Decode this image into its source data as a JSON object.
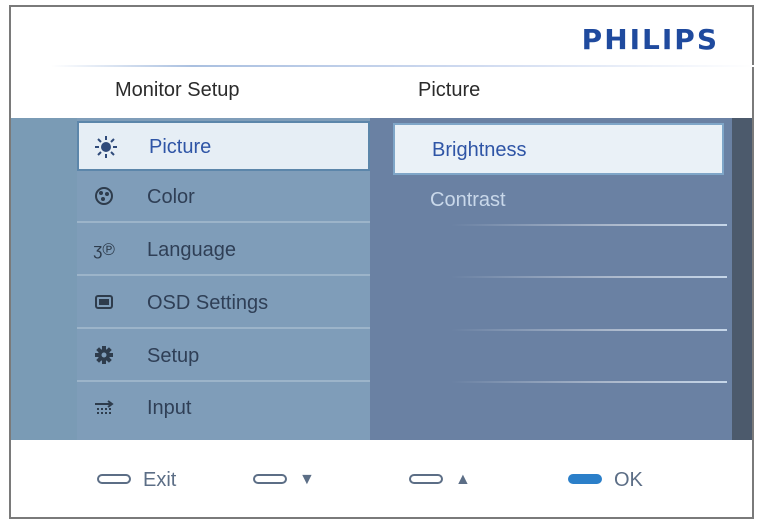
{
  "brand": "PHILIPS",
  "headers": {
    "left": "Monitor Setup",
    "right": "Picture"
  },
  "menu": [
    {
      "label": "Picture",
      "icon": "sun-icon",
      "selected": true
    },
    {
      "label": "Color",
      "icon": "palette-icon",
      "selected": false
    },
    {
      "label": "Language",
      "icon": "language-icon",
      "selected": false
    },
    {
      "label": "OSD Settings",
      "icon": "monitor-icon",
      "selected": false
    },
    {
      "label": "Setup",
      "icon": "gear-icon",
      "selected": false
    },
    {
      "label": "Input",
      "icon": "input-icon",
      "selected": false
    }
  ],
  "submenu": [
    {
      "label": "Brightness",
      "selected": true
    },
    {
      "label": "Contrast",
      "selected": false
    }
  ],
  "footer": {
    "exit": "Exit",
    "down": "▼",
    "up": "▲",
    "ok": "OK"
  },
  "colors": {
    "brand": "#1f4a9e",
    "selected_text": "#2f55a6",
    "ok_button": "#2b7fc9"
  }
}
